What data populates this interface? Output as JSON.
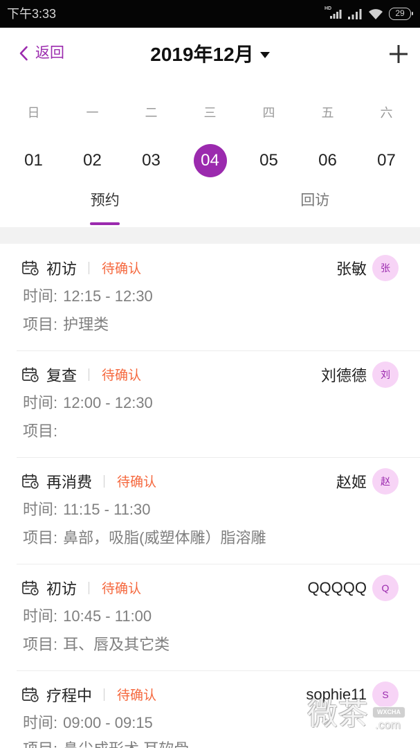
{
  "status_bar": {
    "time": "下午3:33",
    "network_label": "HD",
    "battery_level": "29",
    "icons": [
      "signal-hd-icon",
      "signal-icon",
      "wifi-icon",
      "battery-icon"
    ]
  },
  "header": {
    "back_label": "返回",
    "title": "2019年12月",
    "icons": {
      "back": "chevron-left-icon",
      "dropdown": "caret-down-icon",
      "add": "plus-icon"
    }
  },
  "calendar": {
    "weekdays": [
      "日",
      "一",
      "二",
      "三",
      "四",
      "五",
      "六"
    ],
    "dates": [
      "01",
      "02",
      "03",
      "04",
      "05",
      "06",
      "07"
    ],
    "selected_date": "04"
  },
  "tabs": [
    {
      "label": "预约",
      "active": true
    },
    {
      "label": "回访",
      "active": false
    }
  ],
  "labels": {
    "time": "时间:",
    "project": "项目:"
  },
  "appointments": [
    {
      "icon": "calendar-clock-icon",
      "type": "初访",
      "status": "待确认",
      "name": "张敏",
      "avatar_initial": "张",
      "time": "12:15 - 12:30",
      "project": "护理类"
    },
    {
      "icon": "calendar-clock-icon",
      "type": "复查",
      "status": "待确认",
      "name": "刘德德",
      "avatar_initial": "刘",
      "time": "12:00 - 12:30",
      "project": ""
    },
    {
      "icon": "calendar-clock-icon",
      "type": "再消费",
      "status": "待确认",
      "name": "赵姬",
      "avatar_initial": "赵",
      "time": "11:15 - 11:30",
      "project": "鼻部，吸脂(威塑体雕）脂溶雕"
    },
    {
      "icon": "calendar-clock-icon",
      "type": "初访",
      "status": "待确认",
      "name": "QQQQQ",
      "avatar_initial": "Q",
      "time": "10:45 - 11:00",
      "project": "耳、唇及其它类"
    },
    {
      "icon": "calendar-clock-icon",
      "type": "疗程中",
      "status": "待确认",
      "name": "sophie11",
      "avatar_initial": "S",
      "time": "09:00 - 09:15",
      "project": "鼻尖成形术 耳软骨"
    }
  ],
  "watermark": {
    "main": "微茶",
    "badge": "WXCHA",
    "suffix": ".com"
  },
  "colors": {
    "accent": "#9b2aae",
    "status_pending": "#f5683e",
    "avatar_bg": "#f7d4f6",
    "status_bar_bg": "#050505",
    "section_gap": "#f2f2f2"
  }
}
